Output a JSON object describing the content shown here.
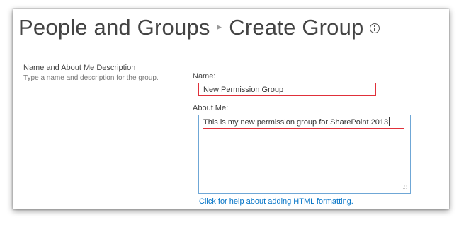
{
  "header": {
    "title_part1": "People and Groups",
    "separator": "▸",
    "title_part2": "Create Group"
  },
  "section": {
    "title": "Name and About Me Description",
    "description": "Type a name and description for the group."
  },
  "form": {
    "name_label": "Name:",
    "name_value": "New Permission Group",
    "about_label": "About Me:",
    "about_value": "This is my new permission group for SharePoint 2013",
    "help_link": "Click for help about adding HTML formatting."
  },
  "colors": {
    "annotation_red": "#e0303a",
    "link_blue": "#0072c6",
    "focus_border": "#6fa7d6"
  },
  "icons": {
    "title_info": "info-icon",
    "textarea_grip": "resize-grip-icon"
  }
}
